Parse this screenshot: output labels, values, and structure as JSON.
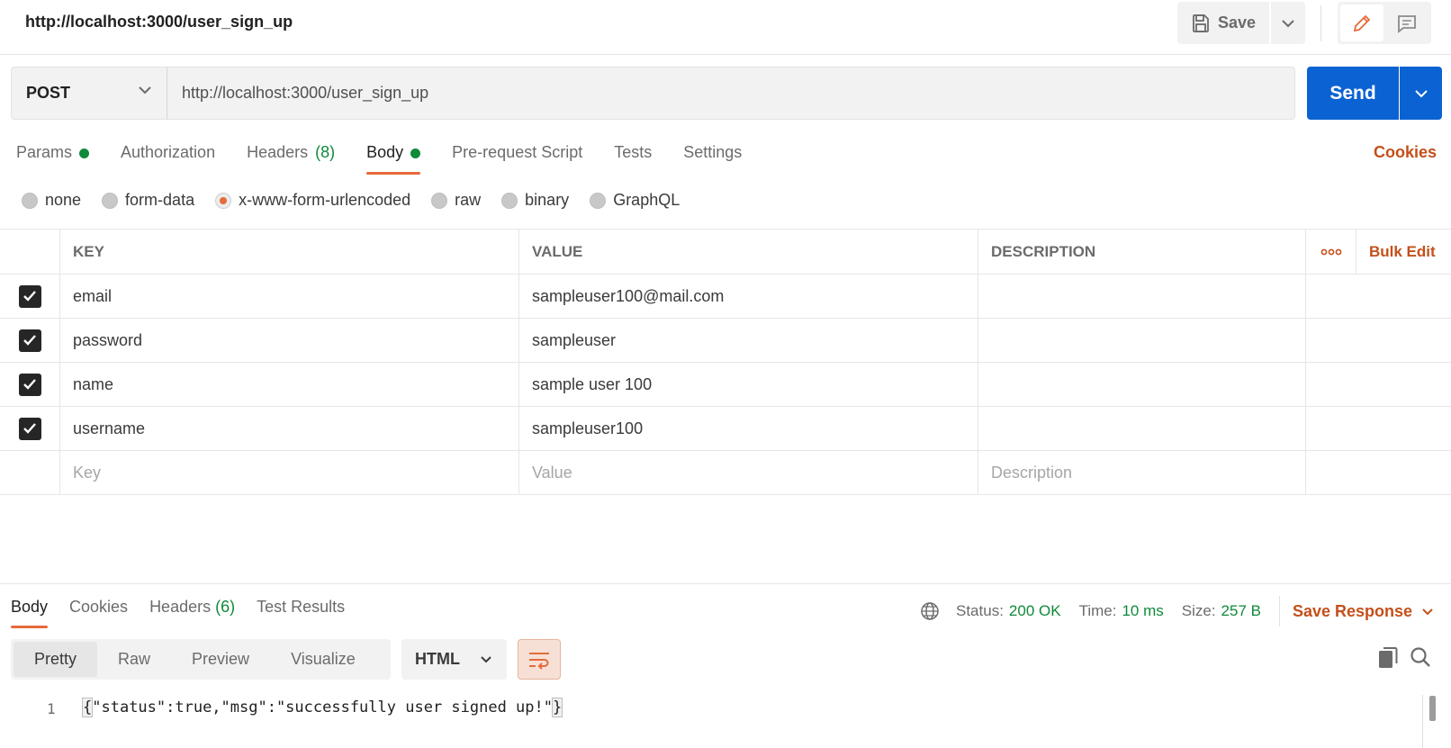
{
  "header": {
    "title": "http://localhost:3000/user_sign_up",
    "save_label": "Save"
  },
  "request": {
    "method": "POST",
    "url": "http://localhost:3000/user_sign_up",
    "send_label": "Send"
  },
  "request_tabs": {
    "params": "Params",
    "authorization": "Authorization",
    "headers": "Headers",
    "headers_count": "(8)",
    "body": "Body",
    "pre_request": "Pre-request Script",
    "tests": "Tests",
    "settings": "Settings",
    "cookies": "Cookies",
    "active": "Body"
  },
  "body_types": {
    "none": "none",
    "form_data": "form-data",
    "urlencoded": "x-www-form-urlencoded",
    "raw": "raw",
    "binary": "binary",
    "graphql": "GraphQL",
    "selected": "x-www-form-urlencoded"
  },
  "params_table": {
    "headers": {
      "key": "KEY",
      "value": "VALUE",
      "description": "DESCRIPTION",
      "bulk_edit": "Bulk Edit"
    },
    "rows": [
      {
        "key": "email",
        "value": "sampleuser100@mail.com",
        "description": "",
        "checked": true
      },
      {
        "key": "password",
        "value": "sampleuser",
        "description": "",
        "checked": true
      },
      {
        "key": "name",
        "value": "sample user 100",
        "description": "",
        "checked": true
      },
      {
        "key": "username",
        "value": "sampleuser100",
        "description": "",
        "checked": true
      }
    ],
    "placeholders": {
      "key": "Key",
      "value": "Value",
      "description": "Description"
    }
  },
  "response": {
    "tabs": {
      "body": "Body",
      "cookies": "Cookies",
      "headers": "Headers",
      "headers_count": "(6)",
      "test_results": "Test Results",
      "active": "Body"
    },
    "status_label": "Status:",
    "status_value": "200 OK",
    "time_label": "Time:",
    "time_value": "10 ms",
    "size_label": "Size:",
    "size_value": "257 B",
    "save_response": "Save Response",
    "views": {
      "pretty": "Pretty",
      "raw": "Raw",
      "preview": "Preview",
      "visualize": "Visualize",
      "active": "Pretty"
    },
    "language": "HTML",
    "line_number": "1",
    "code_open": "{",
    "code_body": "\"status\":true,\"msg\":\"successfully user signed up!\"",
    "code_close": "}"
  },
  "colors": {
    "accent": "#e66a3a",
    "send_blue": "#0b62d2",
    "success_green": "#0f8a3a",
    "link_orange": "#c3501a"
  }
}
